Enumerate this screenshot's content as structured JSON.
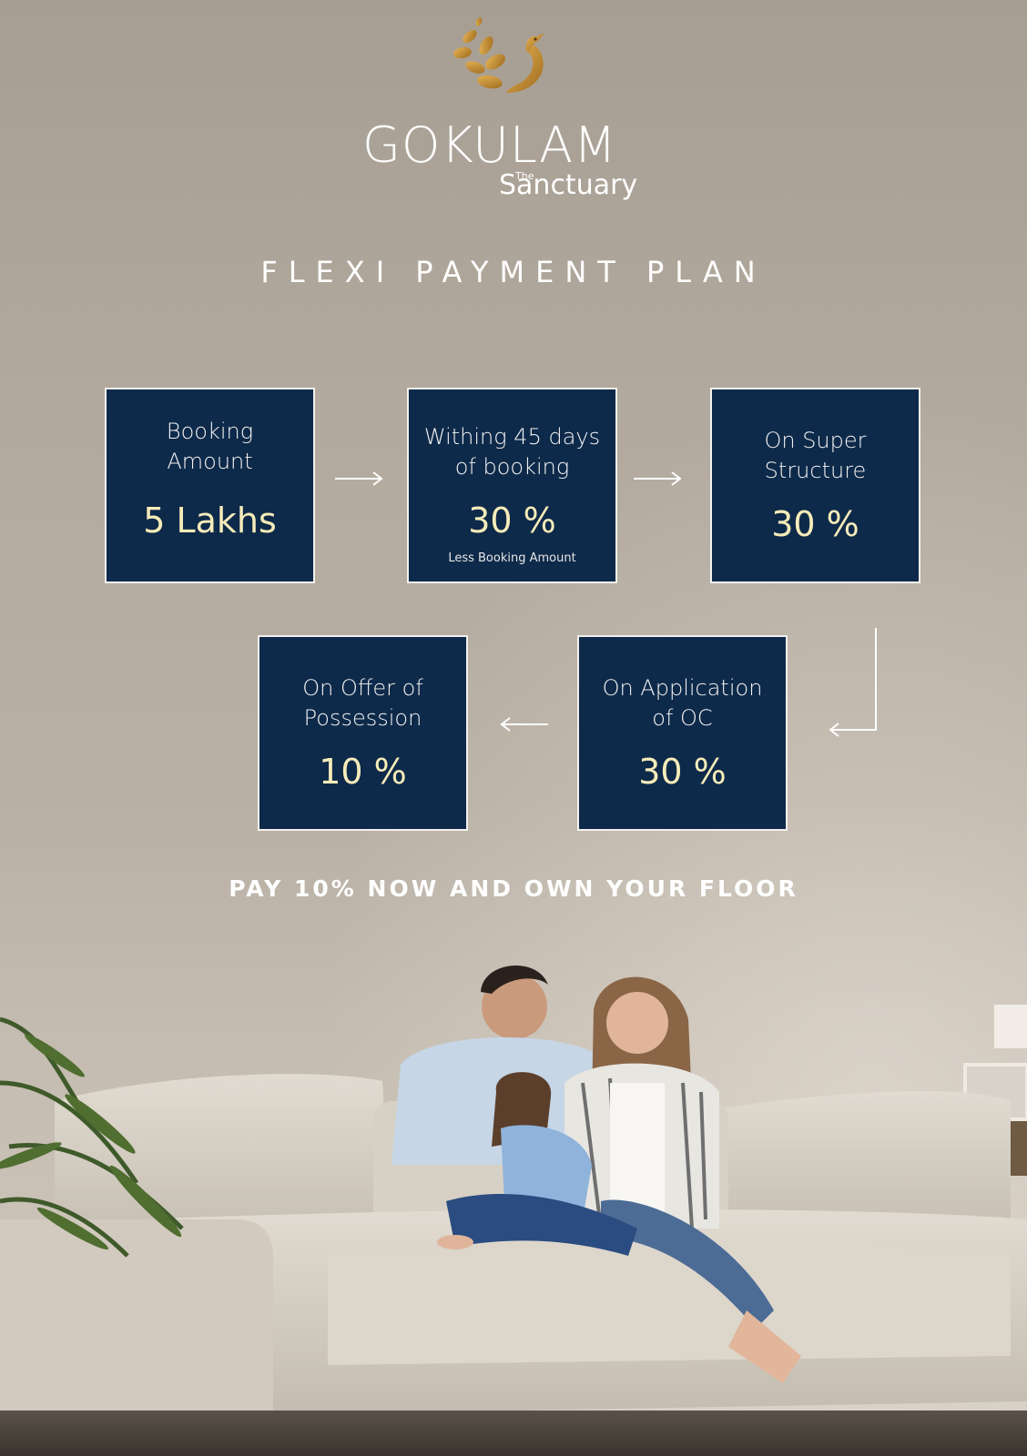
{
  "brand": {
    "name": "GOKULAM",
    "the": "The",
    "subtitle": "Sanctuary"
  },
  "title": "FLEXI PAYMENT PLAN",
  "steps": [
    {
      "label_line1": "Booking",
      "label_line2": "Amount",
      "value": "5 Lakhs",
      "note": ""
    },
    {
      "label_line1": "Withing 45 days",
      "label_line2": "of booking",
      "value": "30 %",
      "note": "Less Booking Amount"
    },
    {
      "label_line1": "On Super",
      "label_line2": "Structure",
      "value": "30 %",
      "note": ""
    },
    {
      "label_line1": "On Application",
      "label_line2": "of OC",
      "value": "30 %",
      "note": ""
    },
    {
      "label_line1": "On Offer of",
      "label_line2": "Possession",
      "value": "10 %",
      "note": ""
    }
  ],
  "tagline": "PAY 10% NOW AND OWN YOUR FLOOR",
  "colors": {
    "box_bg": "#0e2a4a",
    "value_text": "#f6ecb9",
    "logo_gold": "#c8912f"
  },
  "icons": [
    "peacock-logo-icon",
    "arrow-right-icon",
    "arrow-left-icon",
    "arrow-corner-down-left-icon"
  ]
}
